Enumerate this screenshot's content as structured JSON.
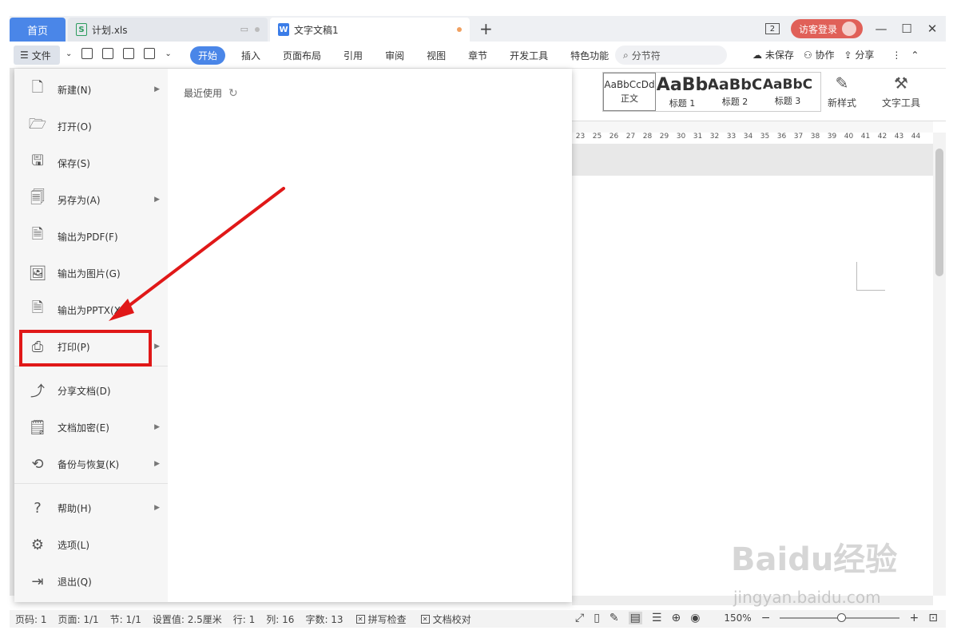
{
  "tabs": {
    "home": "首页",
    "xls": "计划.xls",
    "doc": "文字文稿1",
    "plus": "+"
  },
  "window": {
    "badge": "2",
    "login": "访客登录",
    "minimize": "—",
    "maximize": "☐",
    "close": "✕"
  },
  "toolbar": {
    "file_label": "文件",
    "menu_tabs": [
      "开始",
      "插入",
      "页面布局",
      "引用",
      "审阅",
      "视图",
      "章节",
      "开发工具",
      "特色功能"
    ],
    "search_placeholder": "分节符",
    "unsaved": "未保存",
    "collab": "协作",
    "share": "分享"
  },
  "ribbon": {
    "styles": [
      {
        "sample": "AaBbCcDd",
        "name": "正文"
      },
      {
        "sample": "AaBb",
        "name": "标题 1"
      },
      {
        "sample": "AaBbC",
        "name": "标题 2"
      },
      {
        "sample": "AaBbC",
        "name": "标题 3"
      }
    ],
    "new_style": "新样式",
    "text_tools": "文字工具"
  },
  "ruler": [
    "23",
    "25",
    "26",
    "27",
    "28",
    "29",
    "30",
    "31",
    "32",
    "33",
    "34",
    "35",
    "36",
    "37",
    "38",
    "39",
    "40",
    "41",
    "42",
    "43",
    "44"
  ],
  "file_menu": {
    "items": [
      {
        "label": "新建(N)",
        "has_arrow": true
      },
      {
        "label": "打开(O)",
        "has_arrow": false
      },
      {
        "label": "保存(S)",
        "has_arrow": false
      },
      {
        "label": "另存为(A)",
        "has_arrow": true
      },
      {
        "label": "输出为PDF(F)",
        "has_arrow": false
      },
      {
        "label": "输出为图片(G)",
        "has_arrow": false
      },
      {
        "label": "输出为PPTX(X)",
        "has_arrow": false
      },
      {
        "label": "打印(P)",
        "has_arrow": true
      },
      {
        "label": "分享文档(D)",
        "has_arrow": false
      },
      {
        "label": "文档加密(E)",
        "has_arrow": true
      },
      {
        "label": "备份与恢复(K)",
        "has_arrow": true
      },
      {
        "label": "帮助(H)",
        "has_arrow": true
      },
      {
        "label": "选项(L)",
        "has_arrow": false
      },
      {
        "label": "退出(Q)",
        "has_arrow": false
      }
    ],
    "recent_label": "最近使用"
  },
  "statusbar": {
    "page_code": "页码: 1",
    "pages": "页面: 1/1",
    "section": "节: 1/1",
    "setting": "设置值: 2.5厘米",
    "row": "行: 1",
    "col": "列: 16",
    "words": "字数: 13",
    "spell": "拼写检查",
    "proof": "文档校对",
    "zoom": "150%"
  },
  "watermark": {
    "brand": "Baidu经验",
    "url": "jingyan.baidu.com"
  },
  "colors": {
    "accent": "#4a86e8",
    "highlight": "#e01818",
    "login": "#e06058"
  }
}
